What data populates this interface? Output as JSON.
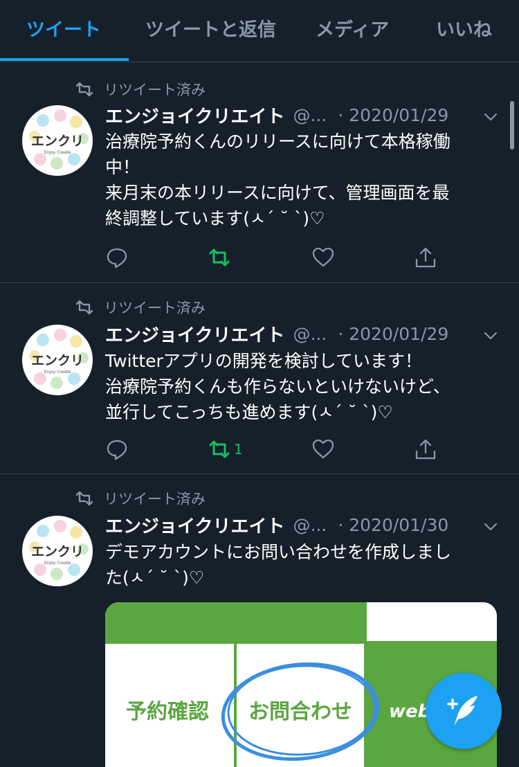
{
  "tabs": [
    {
      "label": "ツイート",
      "active": true
    },
    {
      "label": "ツイートと返信",
      "active": false
    },
    {
      "label": "メディア",
      "active": false
    },
    {
      "label": "いいね",
      "active": false
    }
  ],
  "colors": {
    "background": "#15202b",
    "accent": "#1da1f2",
    "muted": "#8899a6",
    "retweet_green": "#17bf63",
    "divider": "#38444d"
  },
  "tweets": [
    {
      "retweet_label": "リツイート済み",
      "avatar_text": "エンクリ",
      "avatar_sub": "Enjoy Create",
      "name": "エンジョイクリエイト",
      "handle": "@...",
      "date": "· 2020/01/29",
      "lines": [
        "治療院予約くんのリリースに向けて本格稼働",
        "中！",
        "来月末の本リリースに向けて、管理画面を最",
        "終調整しています(ㅅ´ ˘ `)♡"
      ],
      "retweet_count": ""
    },
    {
      "retweet_label": "リツイート済み",
      "avatar_text": "エンクリ",
      "avatar_sub": "Enjoy Create",
      "name": "エンジョイクリエイト",
      "handle": "@...",
      "date": "· 2020/01/29",
      "lines": [
        "Twitterアプリの開発を検討しています！",
        "治療院予約くんも作らないといけないけど、",
        "並行してこっちも進めます(ㅅ´ ˘ `)♡"
      ],
      "retweet_count": "1"
    },
    {
      "retweet_label": "リツイート済み",
      "avatar_text": "エンクリ",
      "avatar_sub": "Enjoy Create",
      "name": "エンジョイクリエイト",
      "handle": "@...",
      "date": "· 2020/01/30",
      "lines": [
        "デモアカウントにお問い合わせを作成しまし",
        "た(ㅅ´ ˘ `)♡"
      ],
      "retweet_count": "",
      "media": {
        "cells": [
          "予約確認",
          "お問合わせ",
          "web"
        ]
      }
    }
  ],
  "icons": {
    "retweet": "retweet-icon",
    "reply": "reply-icon",
    "like": "heart-icon",
    "share": "share-icon",
    "compose": "compose-tweet-icon",
    "caret": "chevron-down-icon"
  }
}
